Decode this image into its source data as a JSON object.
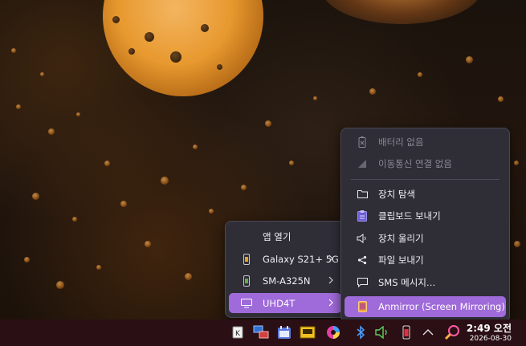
{
  "context_menu": {
    "header": "앱 열기",
    "devices": [
      {
        "label": "Galaxy S21+ 5G",
        "icon": "phone-icon"
      },
      {
        "label": "SM-A325N",
        "icon": "phone-icon"
      },
      {
        "label": "UHD4T",
        "icon": "monitor-icon",
        "selected": true
      }
    ]
  },
  "submenu": {
    "status": [
      {
        "label": "배터리 없음",
        "icon": "battery-none-icon"
      },
      {
        "label": "이동통신 연결 없음",
        "icon": "no-signal-icon"
      }
    ],
    "actions": [
      {
        "label": "장치 탐색",
        "icon": "folder-icon"
      },
      {
        "label": "클립보드 보내기",
        "icon": "clipboard-icon"
      },
      {
        "label": "장치 울리기",
        "icon": "speaker-ring-icon"
      },
      {
        "label": "파일 보내기",
        "icon": "share-icon"
      },
      {
        "label": "SMS 메시지…",
        "icon": "message-icon"
      },
      {
        "label": "Anmirror (Screen Mirroring)",
        "icon": "mirror-icon",
        "selected": true
      }
    ]
  },
  "taskbar": {
    "clock": {
      "time": "2:49 오전",
      "date": "2026-08-30"
    },
    "tray_icons": [
      "app-k-icon",
      "network-monitor-icon",
      "calendar-app-icon",
      "ethernet-icon",
      "color-wheel-icon",
      "bluetooth-icon",
      "volume-icon",
      "phone-battery-icon",
      "chevron-up-icon",
      "search-app-icon"
    ]
  },
  "colors": {
    "menu_bg": "#2f2d36",
    "accent_selected": "#9f6ad9",
    "taskbar_bg": "#2a0f14"
  }
}
